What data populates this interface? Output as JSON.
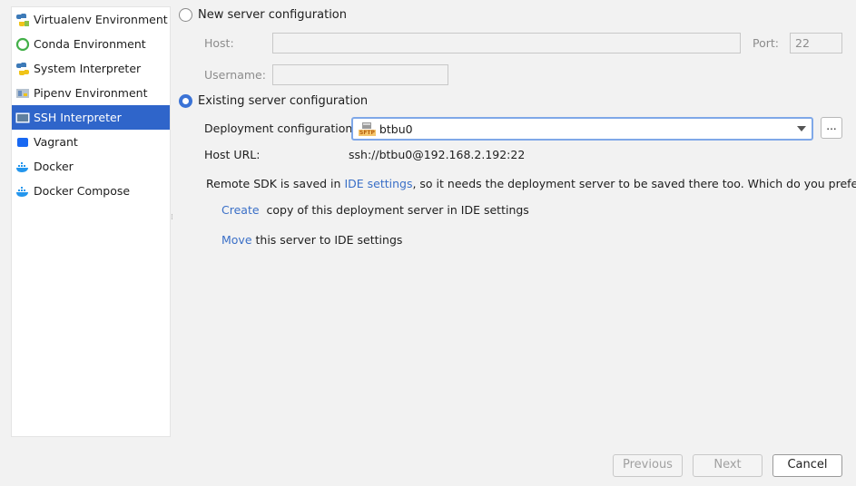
{
  "sidebar": {
    "items": [
      {
        "label": "Virtualenv Environment",
        "icon": "python-icon"
      },
      {
        "label": "Conda Environment",
        "icon": "conda-icon"
      },
      {
        "label": "System Interpreter",
        "icon": "python-icon"
      },
      {
        "label": "Pipenv Environment",
        "icon": "pipenv-icon"
      },
      {
        "label": "SSH Interpreter",
        "icon": "ssh-terminal-icon",
        "selected": true
      },
      {
        "label": "Vagrant",
        "icon": "vagrant-icon"
      },
      {
        "label": "Docker",
        "icon": "docker-icon"
      },
      {
        "label": "Docker Compose",
        "icon": "docker-compose-icon"
      }
    ]
  },
  "new_server": {
    "label": "New server configuration",
    "host_label": "Host:",
    "host_value": "",
    "port_label": "Port:",
    "port_value": "22",
    "username_label": "Username:",
    "username_value": ""
  },
  "existing_server": {
    "label": "Existing server configuration",
    "deployment_label": "Deployment configuration:",
    "deployment_value": "btbu0",
    "deployment_icon_text": "SFTP",
    "dots_label": "...",
    "host_url_label": "Host URL:",
    "host_url_value": "ssh://btbu0@192.168.2.192:22"
  },
  "notice": {
    "prefix": "Remote SDK is saved in ",
    "link": "IDE settings",
    "suffix": ", so it needs the deployment server to be saved there too. Which do you prefer?"
  },
  "options": {
    "create_link": "Create",
    "create_text": "copy of this deployment server in IDE settings",
    "move_link": "Move",
    "move_text": "this server to IDE settings"
  },
  "buttons": {
    "previous": "Previous",
    "next": "Next",
    "cancel": "Cancel"
  },
  "colors": {
    "accent": "#2f65ca",
    "link": "#3a6fc7"
  }
}
